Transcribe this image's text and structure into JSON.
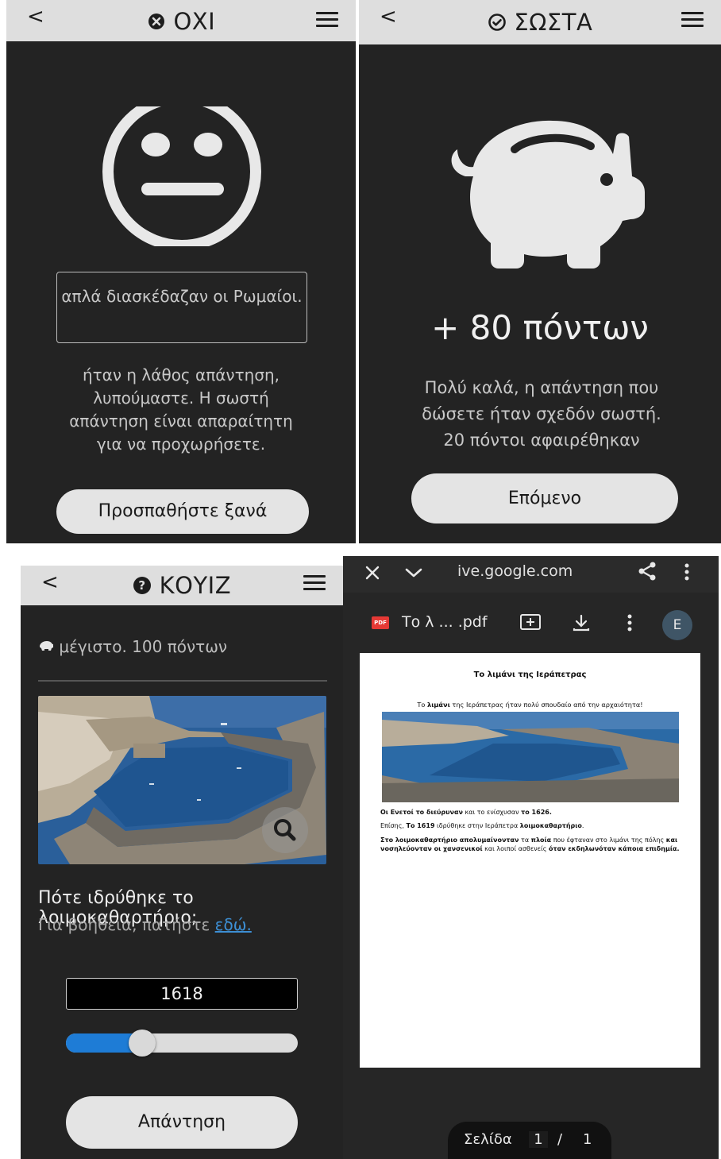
{
  "wrong_screen": {
    "title": "ΟΧΙ",
    "given_answer": "απλά διασκέδαζαν οι Ρωμαίοι.",
    "message_lines": [
      "ήταν η λάθος απάντηση,",
      "λυπούμαστε. Η σωστή",
      "απάντηση είναι απαραίτητη",
      "για να προχωρήσετε."
    ],
    "retry_label": "Προσπαθήστε ξανά"
  },
  "correct_screen": {
    "title": "ΣΩΣΤΑ",
    "points": "+ 80 πόντων",
    "message_lines": [
      "Πολύ καλά, η απάντηση που",
      "δώσετε ήταν σχεδόν σωστή.",
      "20 πόντοι αφαιρέθηκαν"
    ],
    "next_label": "Επόμενο"
  },
  "quiz_screen": {
    "title": "ΚΟΥΙΖ",
    "max_points": "μέγιστο. 100 πόντων",
    "question": "Πότε ιδρύθηκε το λοιμοκαθαρτήριο;",
    "help_text": "Για βοήθεια, πατήστε ",
    "help_link": "εδώ.",
    "year_value": "1618",
    "slider_fraction": 0.33,
    "answer_label": "Απάντηση"
  },
  "pdf_viewer": {
    "url": "ive.google.com",
    "file_name": "Το λ ... .pdf",
    "pdf_badge": "PDF",
    "avatar_letter": "E",
    "doc_title": "Το λιμάνι της Ιεράπετρας",
    "doc_intro_bold": "λιμάνι",
    "doc_intro_pre": "Το ",
    "doc_intro_post": " της Ιεράπετρας ήταν πολύ σπουδαίο από την αρχαιότητα!",
    "doc_p1_a": "Οι Ενετοί το διεύρυναν",
    "doc_p1_b": " και το ενίσχυσαν ",
    "doc_p1_c": "το 1626.",
    "doc_p2_a": "Επίσης, ",
    "doc_p2_b": "Το 1619",
    "doc_p2_c": " ιδρύθηκε στην Ιεράπετρα ",
    "doc_p2_d": "λοιμοκαθαρτήριο",
    "doc_p2_e": ".",
    "doc_p3_a": "Στο λοιμοκαθαρτήριο απολυμαίνονταν",
    "doc_p3_b": " τα ",
    "doc_p3_c": "πλοία",
    "doc_p3_d": " που έφταναν στο λιμάνι της πόλης ",
    "doc_p3_e": "και νοσηλεύονταν οι χανσενικοί",
    "doc_p3_f": " και λοιποί ασθενείς ",
    "doc_p3_g": "όταν εκδηλωνόταν κάποια επιδημία.",
    "page_label": "Σελίδα",
    "page_current": "1",
    "page_sep": "/",
    "page_total": "1"
  },
  "colors": {
    "accent_blue": "#1e7cd6",
    "dark_bg": "#232323",
    "header_bg": "#dedede",
    "pdf_red": "#e53935"
  }
}
